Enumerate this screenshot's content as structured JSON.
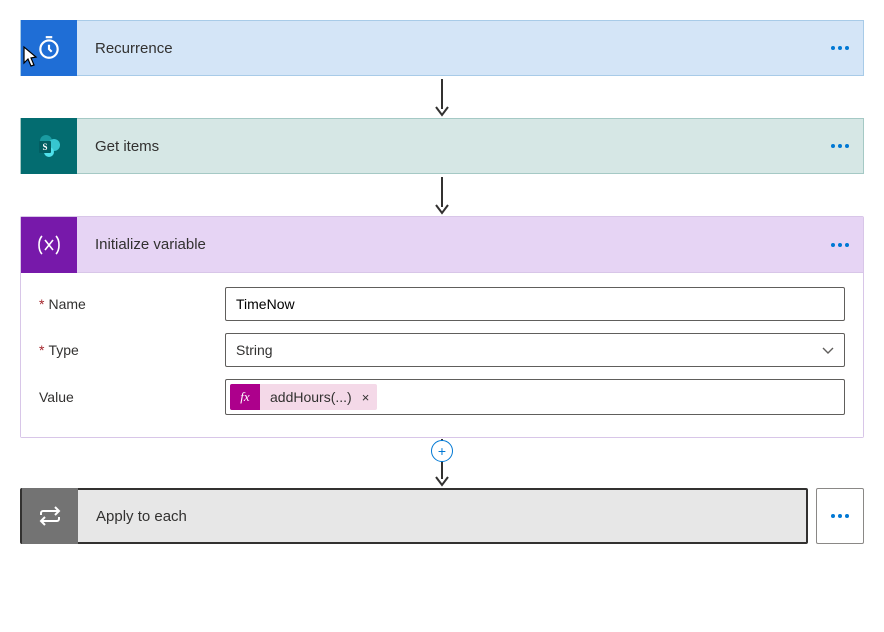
{
  "steps": {
    "recurrence": {
      "title": "Recurrence"
    },
    "getitems": {
      "title": "Get items"
    },
    "initvar": {
      "title": "Initialize variable",
      "fields": {
        "name_label": "Name",
        "name_value": "TimeNow",
        "type_label": "Type",
        "type_value": "String",
        "value_label": "Value"
      },
      "token": {
        "fx_label": "fx",
        "text": "addHours(...)",
        "close": "×"
      }
    },
    "applyeach": {
      "title": "Apply to each"
    }
  },
  "plus_label": "+"
}
